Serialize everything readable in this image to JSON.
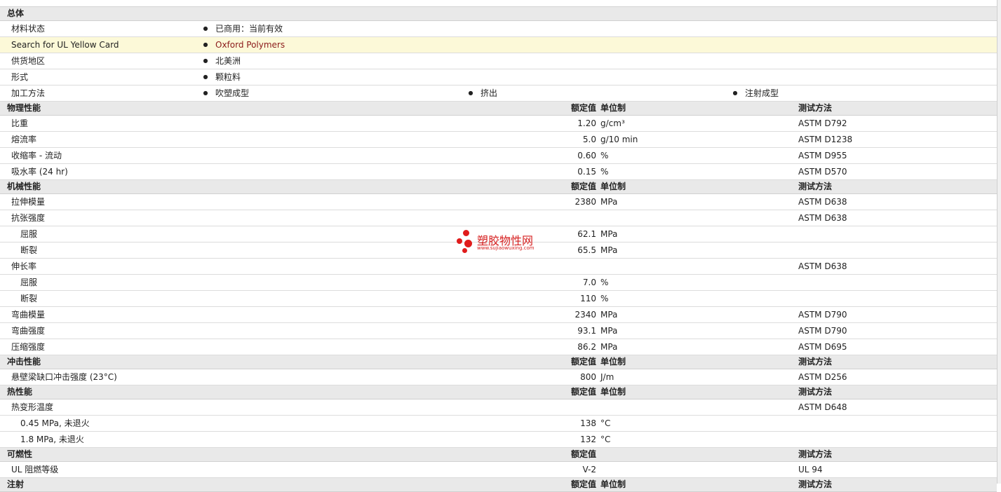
{
  "general": {
    "title": "总体",
    "rows": [
      {
        "label": "材料状态",
        "items": [
          "已商用：当前有效"
        ]
      },
      {
        "label": "Search for UL Yellow Card",
        "items": [
          "Oxford Polymers"
        ],
        "highlight": true
      },
      {
        "label": "供货地区",
        "items": [
          "北美洲"
        ]
      },
      {
        "label": "形式",
        "items": [
          "颗粒料"
        ]
      },
      {
        "label": "加工方法",
        "items": [
          "吹塑成型",
          "挤出",
          "注射成型"
        ]
      }
    ]
  },
  "bullet_glyph": "●",
  "headers": {
    "value": "额定值",
    "unit": "单位制",
    "method": "测试方法"
  },
  "sections": [
    {
      "title": "物理性能",
      "rows": [
        {
          "label": "比重",
          "value": "1.20",
          "unit": "g/cm³",
          "method": "ASTM D792"
        },
        {
          "label": "熔流率",
          "value": "5.0",
          "unit": "g/10 min",
          "method": "ASTM D1238"
        },
        {
          "label": "收缩率  - 流动",
          "value": "0.60",
          "unit": "%",
          "method": "ASTM D955"
        },
        {
          "label": "吸水率  (24 hr)",
          "value": "0.15",
          "unit": "%",
          "method": "ASTM D570"
        }
      ]
    },
    {
      "title": "机械性能",
      "rows": [
        {
          "label": "拉伸模量",
          "value": "2380",
          "unit": "MPa",
          "method": "ASTM D638"
        },
        {
          "label": "抗张强度",
          "value": "",
          "unit": "",
          "method": "ASTM D638",
          "group": true
        },
        {
          "label": "屈服",
          "value": "62.1",
          "unit": "MPa",
          "method": "",
          "sub": true
        },
        {
          "label": "断裂",
          "value": "65.5",
          "unit": "MPa",
          "method": "",
          "sub": true
        },
        {
          "label": "伸长率",
          "value": "",
          "unit": "",
          "method": "ASTM D638",
          "group": true
        },
        {
          "label": "屈服",
          "value": "7.0",
          "unit": "%",
          "method": "",
          "sub": true
        },
        {
          "label": "断裂",
          "value": "110",
          "unit": "%",
          "method": "",
          "sub": true
        },
        {
          "label": "弯曲模量",
          "value": "2340",
          "unit": "MPa",
          "method": "ASTM D790"
        },
        {
          "label": "弯曲强度",
          "value": "93.1",
          "unit": "MPa",
          "method": "ASTM D790"
        },
        {
          "label": "压缩强度",
          "value": "86.2",
          "unit": "MPa",
          "method": "ASTM D695"
        }
      ]
    },
    {
      "title": "冲击性能",
      "rows": [
        {
          "label": "悬壁梁缺口冲击强度  (23°C)",
          "value": "800",
          "unit": "J/m",
          "method": "ASTM D256"
        }
      ]
    },
    {
      "title": "热性能",
      "rows": [
        {
          "label": "热变形温度",
          "value": "",
          "unit": "",
          "method": "ASTM D648",
          "group": true
        },
        {
          "label": "0.45 MPa, 未退火",
          "value": "138",
          "unit": "°C",
          "method": "",
          "sub": true
        },
        {
          "label": "1.8 MPa, 未退火",
          "value": "132",
          "unit": "°C",
          "method": "",
          "sub": true
        }
      ]
    },
    {
      "title": "可燃性",
      "hide_unit_header": true,
      "rows": [
        {
          "label": "UL 阻燃等级",
          "value": "V-2",
          "unit": "",
          "method": "UL 94"
        }
      ]
    },
    {
      "title": "注射",
      "rows": []
    }
  ],
  "watermark": {
    "name": "塑胶物性网",
    "url": "www.sujiaowuxing.com"
  }
}
